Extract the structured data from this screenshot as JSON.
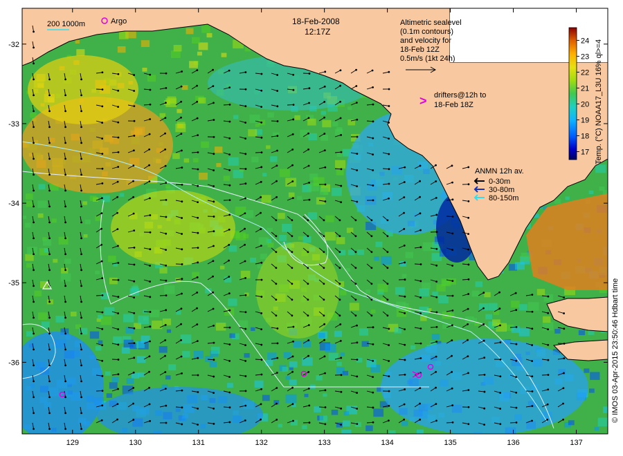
{
  "map": {
    "date": "18-Feb-2008",
    "time": "12:17Z",
    "lon_ticks": [
      "129",
      "130",
      "131",
      "132",
      "133",
      "134",
      "135",
      "136",
      "137"
    ],
    "lat_ticks": [
      "-32",
      "-33",
      "-34",
      "-35",
      "-36"
    ],
    "lon_range": [
      128.2,
      137.5
    ],
    "lat_range": [
      -36.9,
      -31.55
    ]
  },
  "legend_topleft": {
    "scale_label": "200  1000m",
    "argo_label": "Argo"
  },
  "altimetry_note": {
    "line1": "Altimetric sealevel",
    "line2": "(0.1m contours)",
    "line3": "and velocity for",
    "line4": "18-Feb 12Z",
    "line5": "0.5m/s (1kt 24h)"
  },
  "drifters_note": {
    "symbol": ">",
    "line1": "drifters@12h to",
    "line2": "18-Feb 18Z"
  },
  "anmn_legend": {
    "title": "ANMN 12h av.",
    "items": [
      {
        "label": "0-30m",
        "color": "#000000"
      },
      {
        "label": "30-80m",
        "color": "#1030c0"
      },
      {
        "label": "80-150m",
        "color": "#30e0f0"
      }
    ]
  },
  "colorbar": {
    "title": "Temp. (°C) NOAA17_L3U 16% ql>=4",
    "ticks": [
      "17",
      "18",
      "19",
      "20",
      "21",
      "22",
      "23",
      "24"
    ],
    "range": [
      16.5,
      24.8
    ],
    "colors": [
      "#000060",
      "#0000c8",
      "#0050ff",
      "#0096ff",
      "#18c8f0",
      "#20d0b0",
      "#40c850",
      "#50d020",
      "#a0dc10",
      "#e6e010",
      "#ffb000",
      "#f07800",
      "#c83c00",
      "#8c0000"
    ]
  },
  "credit": "© IMOS 03-Apr-2015 23:50:46 Hdbart time",
  "colors": {
    "land": "#f8c8a0",
    "frame": "#000000",
    "contour": "#e8f0ff",
    "argo": "#e000e0"
  }
}
